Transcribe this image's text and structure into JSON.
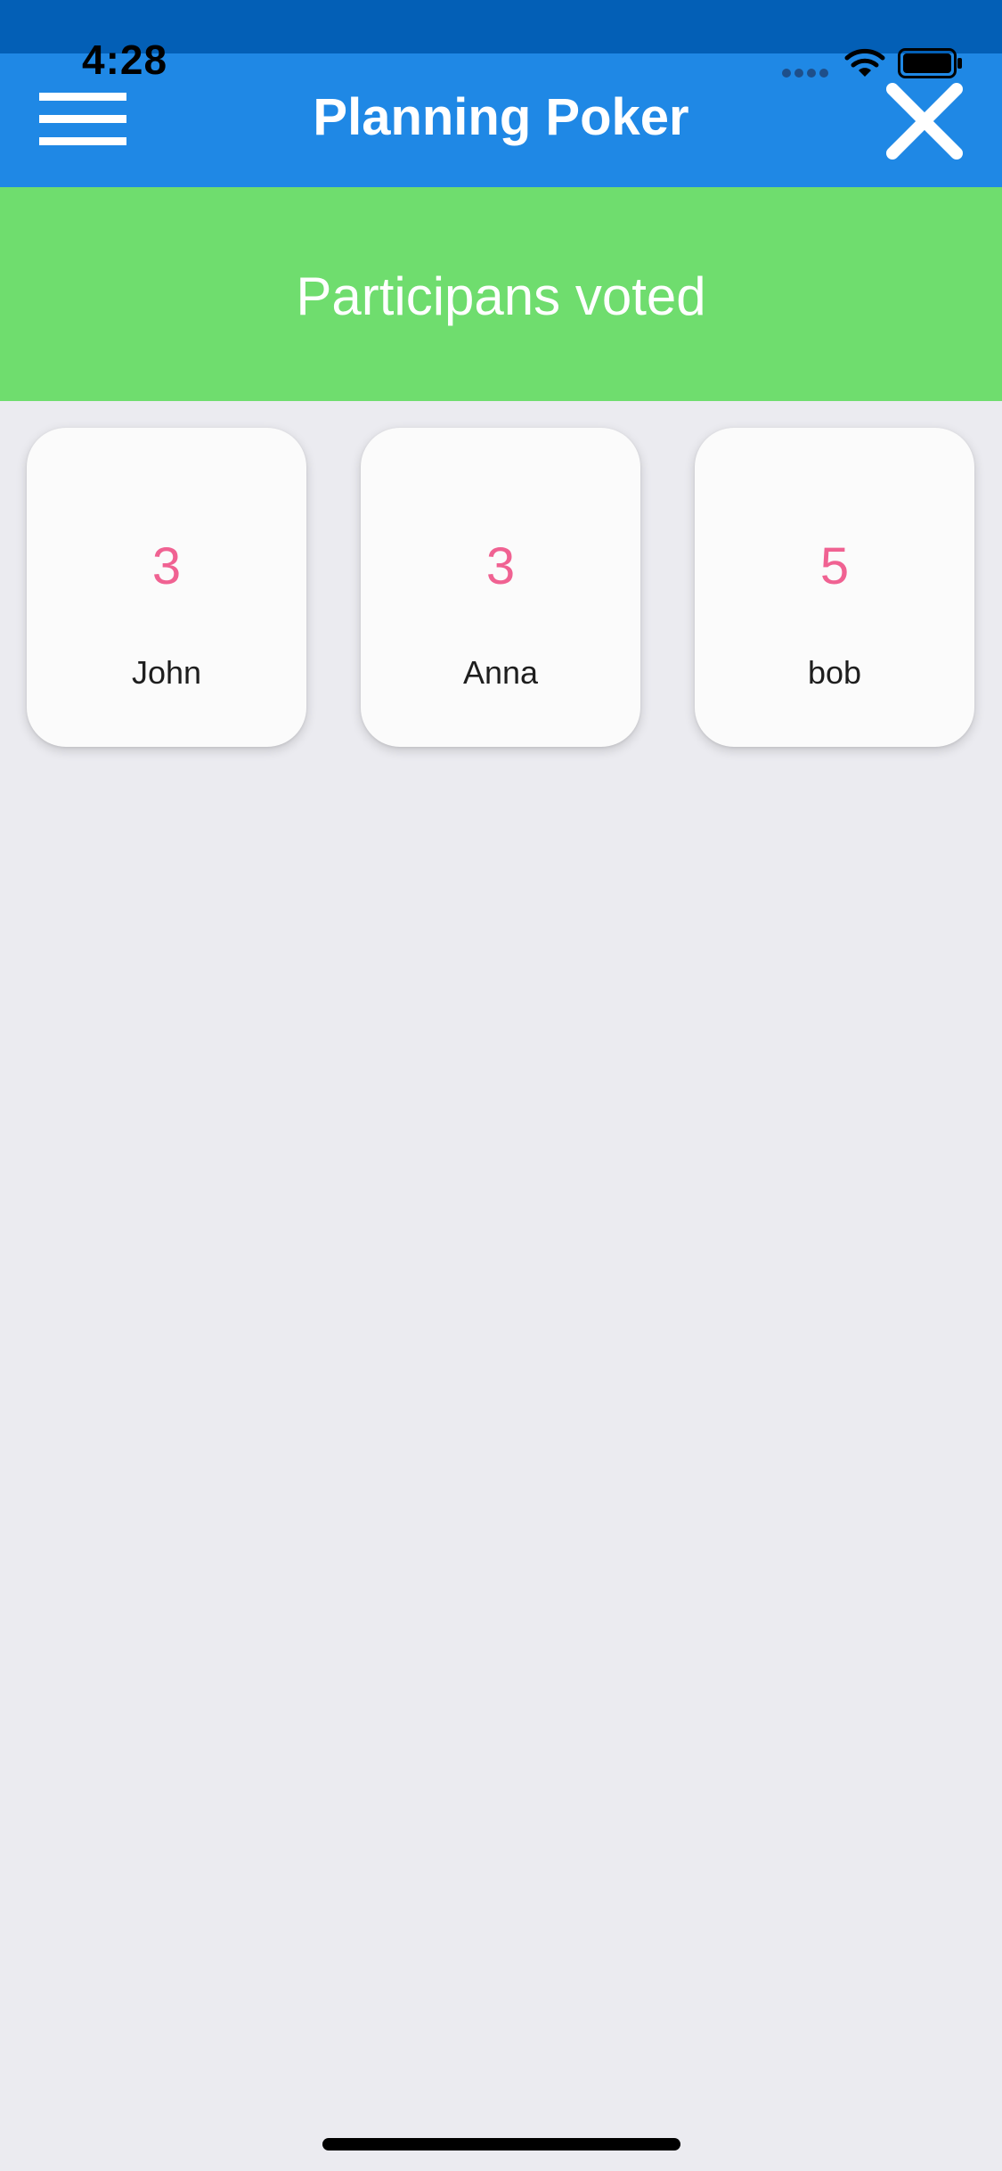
{
  "status_bar": {
    "time": "4:28"
  },
  "app_bar": {
    "title": "Planning Poker",
    "menu_icon": "hamburger-menu-icon",
    "close_icon": "close-icon",
    "color": "#1f88e5"
  },
  "banner": {
    "text": "Participans voted",
    "color": "#6fdd6e"
  },
  "votes": [
    {
      "value": "3",
      "name": "John"
    },
    {
      "value": "3",
      "name": "Anna"
    },
    {
      "value": "5",
      "name": "bob"
    }
  ],
  "colors": {
    "vote_value": "#f06292",
    "background": "#ebebf0"
  }
}
